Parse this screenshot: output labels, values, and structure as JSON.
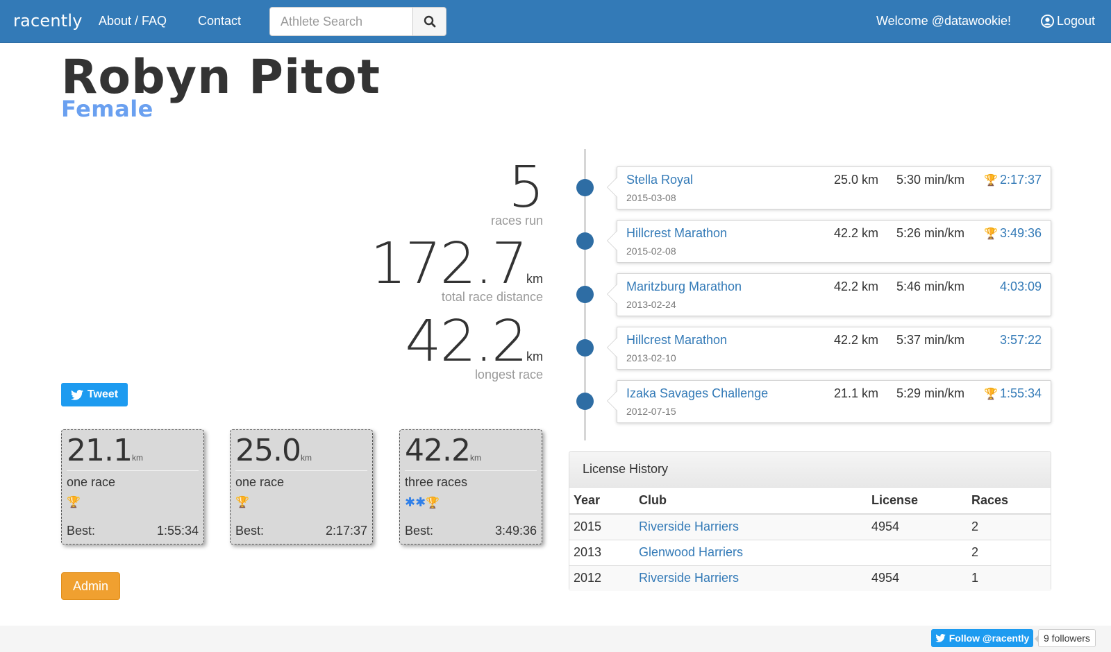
{
  "nav": {
    "brand": "racently",
    "about": "About / FAQ",
    "contact": "Contact",
    "search_placeholder": "Athlete Search",
    "welcome": "Welcome @datawookie!",
    "logout": "Logout"
  },
  "athlete": {
    "name": "Robyn Pitot",
    "gender": "Female"
  },
  "stats": {
    "races_run": "5",
    "races_run_label": "races run",
    "total_distance": "172.7",
    "total_distance_unit": "km",
    "total_distance_label": "total race distance",
    "longest": "42.2",
    "longest_unit": "km",
    "longest_label": "longest race"
  },
  "tweet_label": "Tweet",
  "distance_cards": [
    {
      "distance": "21.1",
      "unit": "km",
      "count": "one race",
      "stars": "",
      "best_label": "Best:",
      "best": "1:55:34"
    },
    {
      "distance": "25.0",
      "unit": "km",
      "count": "one race",
      "stars": "",
      "best_label": "Best:",
      "best": "2:17:37"
    },
    {
      "distance": "42.2",
      "unit": "km",
      "count": "three races",
      "stars": "✱✱",
      "best_label": "Best:",
      "best": "3:49:36"
    }
  ],
  "admin_label": "Admin",
  "races": [
    {
      "name": "Stella Royal",
      "date": "2015-03-08",
      "distance": "25.0 km",
      "pace": "5:30 min/km",
      "time": "2:17:37",
      "trophy": true
    },
    {
      "name": "Hillcrest Marathon",
      "date": "2015-02-08",
      "distance": "42.2 km",
      "pace": "5:26 min/km",
      "time": "3:49:36",
      "trophy": true
    },
    {
      "name": "Maritzburg Marathon",
      "date": "2013-02-24",
      "distance": "42.2 km",
      "pace": "5:46 min/km",
      "time": "4:03:09",
      "trophy": false
    },
    {
      "name": "Hillcrest Marathon",
      "date": "2013-02-10",
      "distance": "42.2 km",
      "pace": "5:37 min/km",
      "time": "3:57:22",
      "trophy": false
    },
    {
      "name": "Izaka Savages Challenge",
      "date": "2012-07-15",
      "distance": "21.1 km",
      "pace": "5:29 min/km",
      "time": "1:55:34",
      "trophy": true
    }
  ],
  "license": {
    "title": "License History",
    "headers": [
      "Year",
      "Club",
      "License",
      "Races"
    ],
    "rows": [
      {
        "year": "2015",
        "club": "Riverside Harriers",
        "license": "4954",
        "races": "2"
      },
      {
        "year": "2013",
        "club": "Glenwood Harriers",
        "license": "",
        "races": "2"
      },
      {
        "year": "2012",
        "club": "Riverside Harriers",
        "license": "4954",
        "races": "1"
      }
    ]
  },
  "footer": {
    "follow": "Follow @racently",
    "followers": "9 followers"
  },
  "colors": {
    "navbar": "#337ab7",
    "gender": "#6aa0f0",
    "link": "#337ab7",
    "trophy": "#c9a22a",
    "admin": "#f0a030",
    "twitter": "#1d9bf0"
  }
}
